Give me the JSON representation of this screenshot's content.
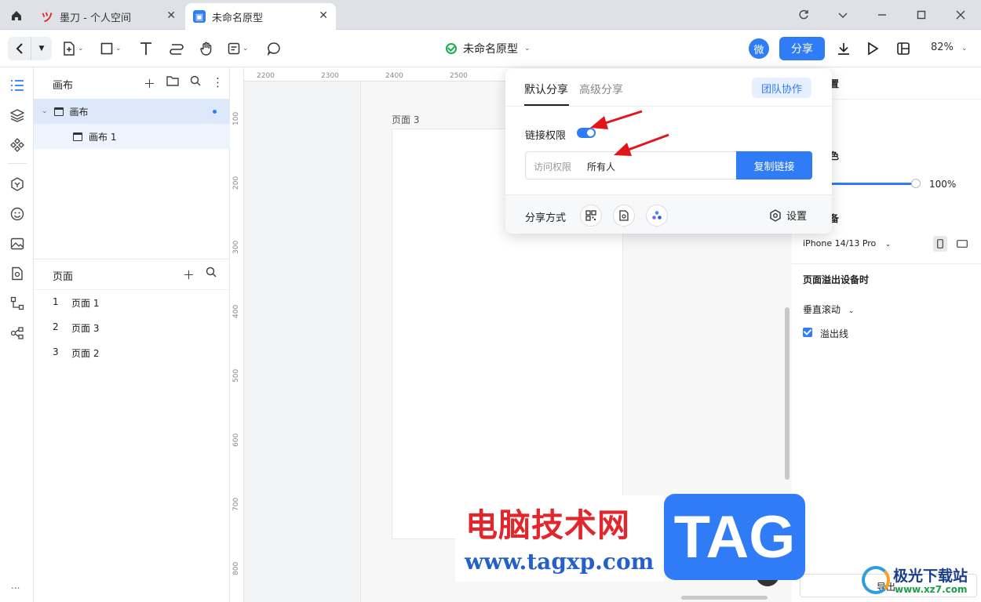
{
  "browser": {
    "tabs": [
      {
        "title": "墨刀 - 个人空间"
      },
      {
        "title": "未命名原型"
      }
    ]
  },
  "toolbar": {
    "doc_title": "未命名原型",
    "wei_label": "微",
    "share_label": "分享",
    "zoom": "82%"
  },
  "layers_panel": {
    "title": "画布",
    "items": [
      {
        "label": "画布"
      },
      {
        "label": "画布 1"
      }
    ]
  },
  "pages_panel": {
    "title": "页面",
    "pages": [
      {
        "num": "1",
        "label": "页面 1"
      },
      {
        "num": "2",
        "label": "页面 3"
      },
      {
        "num": "3",
        "label": "页面 2"
      }
    ]
  },
  "canvas": {
    "ruler_x": [
      "2200",
      "2300",
      "2400",
      "2500"
    ],
    "ruler_y": [
      "100",
      "200",
      "300",
      "400",
      "500",
      "600",
      "700",
      "800"
    ],
    "page_label": "页面 3",
    "help": "?"
  },
  "rail": {
    "more": "..."
  },
  "properties": {
    "heading_partial": "置",
    "bg_color_partial": "色",
    "opacity": "100%",
    "device_partial": "备",
    "device": "iPhone 14/13 Pro",
    "overflow_title": "页面溢出设备时",
    "scroll_mode": "垂直滚动",
    "overflow_line": "溢出线",
    "export_partial": "导出"
  },
  "share_popover": {
    "tab_default": "默认分享",
    "tab_advanced": "高级分享",
    "team_button": "团队协作",
    "link_permission": "链接权限",
    "link_permission_enabled": true,
    "access_label": "访问权限",
    "access_value": "所有人",
    "copy_link": "复制链接",
    "share_methods_label": "分享方式",
    "settings_label": "设置"
  },
  "watermarks": {
    "site_cn": "电脑技术网",
    "site_url": "www.tagxp.com",
    "tag": "TAG",
    "jg_name": "极光下载站",
    "jg_url": "www.xz7.com"
  },
  "colors": {
    "accent": "#2f7cf6",
    "annotation_arrow": "#e0161b",
    "watermark_red": "#e2262b"
  }
}
